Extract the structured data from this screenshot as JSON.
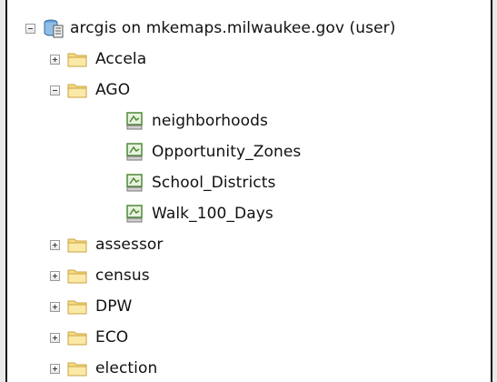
{
  "tree": {
    "root": {
      "label": "arcgis on mkemaps.milwaukee.gov (user)",
      "icon": "database-connection-icon"
    },
    "folders": [
      {
        "label": "Accela",
        "expanded": false
      },
      {
        "label": "AGO",
        "expanded": true,
        "children": [
          {
            "label": "neighborhoods"
          },
          {
            "label": "Opportunity_Zones"
          },
          {
            "label": "School_Districts"
          },
          {
            "label": "Walk_100_Days"
          }
        ]
      },
      {
        "label": "assessor",
        "expanded": false
      },
      {
        "label": "census",
        "expanded": false
      },
      {
        "label": "DPW",
        "expanded": false
      },
      {
        "label": "ECO",
        "expanded": false
      },
      {
        "label": "election",
        "expanded": false
      }
    ]
  },
  "colors": {
    "folder_fill": "#f6dc86",
    "folder_edge": "#c9a440",
    "feature_icon": "#4d8a35"
  }
}
